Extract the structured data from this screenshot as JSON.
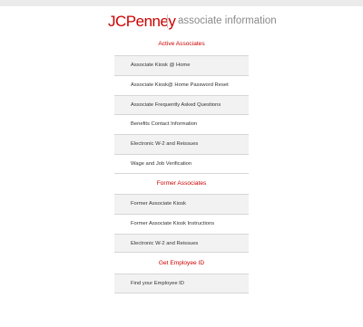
{
  "brand": {
    "logo_text": "JCPenney",
    "tagline": "associate information"
  },
  "sections": [
    {
      "title": "Active Associates",
      "items": [
        "Associate Kiosk @ Home",
        "Associate Kiosk@ Home Password Reset",
        "Associate Frequently Asked Questions",
        "Benefits Contact Information",
        "Electronic W-2 and Reissues",
        "Wage and Job Verification"
      ]
    },
    {
      "title": "Former Associates",
      "items": [
        "Former Associate Kiosk",
        "Former Associate Kiosk Instructions",
        "Electronic W-2 and Reissues"
      ]
    },
    {
      "title": "Get Employee ID",
      "items": [
        "Find your Employee ID"
      ]
    }
  ]
}
